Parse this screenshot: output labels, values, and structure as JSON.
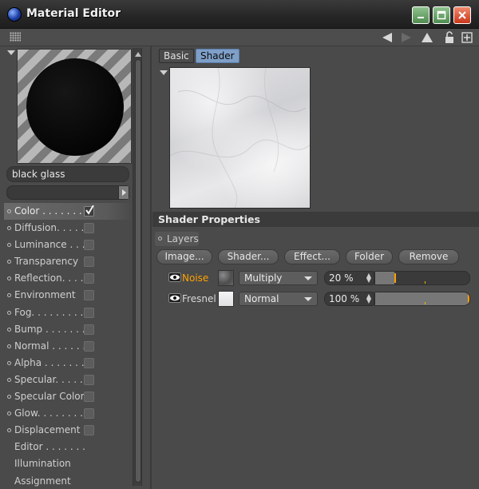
{
  "window": {
    "title": "Material Editor",
    "controls": [
      "minimize-icon",
      "maximize-icon",
      "close-icon"
    ]
  },
  "toolbar": {
    "icons": [
      "grip-icon",
      "back-arrow-icon",
      "forward-arrow-icon",
      "up-arrow-icon",
      "lock-icon",
      "new-window-icon"
    ]
  },
  "material": {
    "name": "black glass",
    "channels": [
      {
        "label": "Color . . . . . . .",
        "checked": true,
        "active": true,
        "has_dot": true
      },
      {
        "label": "Diffusion. . . . .",
        "checked": false,
        "has_dot": true
      },
      {
        "label": "Luminance . . .",
        "checked": false,
        "has_dot": true
      },
      {
        "label": "Transparency",
        "checked": false,
        "has_dot": true
      },
      {
        "label": "Reflection. . . .",
        "checked": false,
        "has_dot": true
      },
      {
        "label": "Environment",
        "checked": false,
        "has_dot": true
      },
      {
        "label": "Fog. . . . . . . . .",
        "checked": false,
        "has_dot": true
      },
      {
        "label": "Bump . . . . . . .",
        "checked": false,
        "has_dot": true
      },
      {
        "label": "Normal . . . . . .",
        "checked": false,
        "has_dot": true
      },
      {
        "label": "Alpha . . . . . . .",
        "checked": false,
        "has_dot": true
      },
      {
        "label": "Specular. . . . .",
        "checked": false,
        "has_dot": true
      },
      {
        "label": "Specular Color",
        "checked": false,
        "has_dot": true
      },
      {
        "label": "Glow. . . . . . . .",
        "checked": false,
        "has_dot": true
      },
      {
        "label": "Displacement",
        "checked": false,
        "has_dot": true
      },
      {
        "label": "Editor . . . . . . .",
        "checkbox": false,
        "has_dot": false
      },
      {
        "label": "Illumination",
        "checkbox": false,
        "has_dot": false
      },
      {
        "label": "Assignment",
        "checkbox": false,
        "has_dot": false
      }
    ]
  },
  "tabs": [
    {
      "label": "Basic",
      "selected": false
    },
    {
      "label": "Shader",
      "selected": true
    }
  ],
  "shader": {
    "section_title": "Shader Properties",
    "layers_label": "Layers",
    "buttons": [
      "Image...",
      "Shader...",
      "Effect...",
      "Folder",
      "Remove"
    ],
    "layers": [
      {
        "name": "Noise",
        "highlighted": true,
        "blend": "Multiply",
        "percent": "20 %",
        "value": 0.2
      },
      {
        "name": "Fresnel",
        "highlighted": false,
        "blend": "Normal",
        "percent": "100 %",
        "value": 1.0
      }
    ]
  },
  "colors": {
    "accent": "#ffa200",
    "tab_selected": "#7ea0c8"
  }
}
